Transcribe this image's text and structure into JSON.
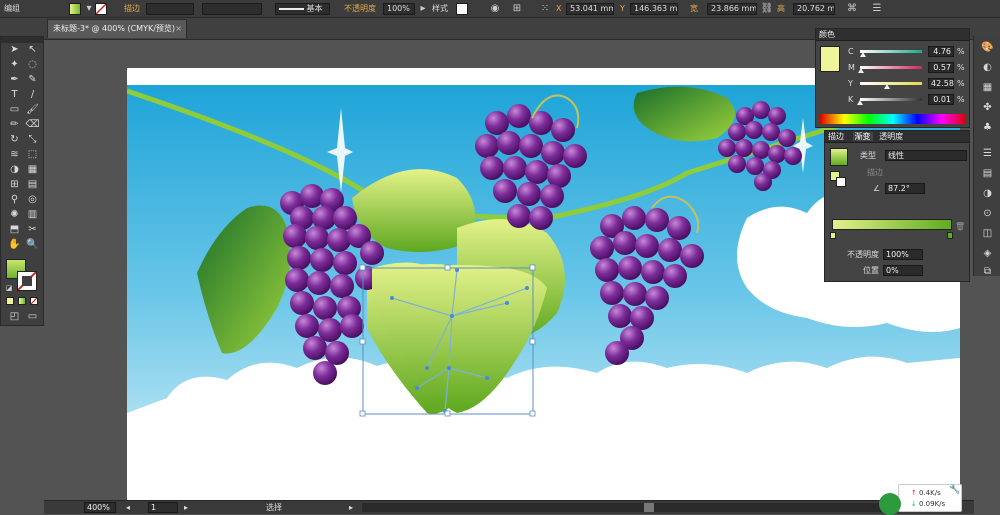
{
  "top": {
    "workspace_label": "编组",
    "stroke_label": "描边",
    "stroke_profile": "基本",
    "opacity_label": "不透明度",
    "opacity_value": "100%",
    "style_label": "样式",
    "x_label": "X",
    "x_value": "53.041 mm",
    "y_label": "Y",
    "y_value": "146.363 mm",
    "w_label": "宽",
    "w_value": "23.866 mm",
    "h_label": "高",
    "h_value": "20.762 mm"
  },
  "document_tab": {
    "title": "未标题-3* @ 400% (CMYK/预览)",
    "close": "×"
  },
  "status": {
    "zoom": "400%",
    "page": "1",
    "tool_name": "选择"
  },
  "color_panel": {
    "title": "颜色",
    "channels": [
      {
        "name": "C",
        "value": "4.76",
        "fill": 0.05,
        "color": "#1fa88a"
      },
      {
        "name": "M",
        "value": "0.57",
        "fill": 0.01,
        "color": "#d6245a"
      },
      {
        "name": "Y",
        "value": "42.58",
        "fill": 0.43,
        "color": "#e8d84a"
      },
      {
        "name": "K",
        "value": "0.01",
        "fill": 0.0,
        "color": "#333333"
      }
    ],
    "percent": "%",
    "swatch_color": "#eef59a"
  },
  "gradient_panel": {
    "tabs": [
      "描边",
      "渐变",
      "透明度"
    ],
    "active_tab": 1,
    "type_label": "类型",
    "type_value": "线性",
    "stroke_label": "描边",
    "angle_value": "87.2°",
    "opacity_label": "不透明度",
    "opacity_value": "100%",
    "position_label": "位置",
    "position_value": "0%",
    "start_color": "#e2f18c",
    "end_color": "#5fab1e"
  },
  "network": {
    "up": "0.4K/s",
    "down": "0.09K/s"
  }
}
